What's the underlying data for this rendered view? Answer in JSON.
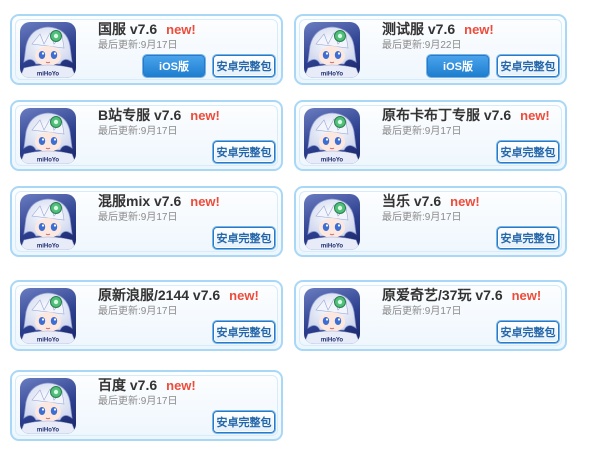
{
  "updated_prefix": "最后更新:",
  "new_label": "new!",
  "ios_label": "iOS版",
  "android_label": "安卓完整包",
  "icon_caption": "miHoYo",
  "cards": [
    {
      "title": "国服 v7.6",
      "date": "9月17日",
      "has_ios": true
    },
    {
      "title": "测试服 v7.6",
      "date": "9月22日",
      "has_ios": true
    },
    {
      "title": "B站专服 v7.6",
      "date": "9月17日",
      "has_ios": false
    },
    {
      "title": "原布卡布丁专服 v7.6",
      "date": "9月17日",
      "has_ios": false
    },
    {
      "title": "混服mix v7.6",
      "date": "9月17日",
      "has_ios": false
    },
    {
      "title": "当乐 v7.6",
      "date": "9月17日",
      "has_ios": false
    },
    {
      "title": "原新浪服/2144 v7.6",
      "date": "9月17日",
      "has_ios": false
    },
    {
      "title": "原爱奇艺/37玩 v7.6",
      "date": "9月17日",
      "has_ios": false
    },
    {
      "title": "百度 v7.6",
      "date": "9月17日",
      "has_ios": false
    }
  ]
}
